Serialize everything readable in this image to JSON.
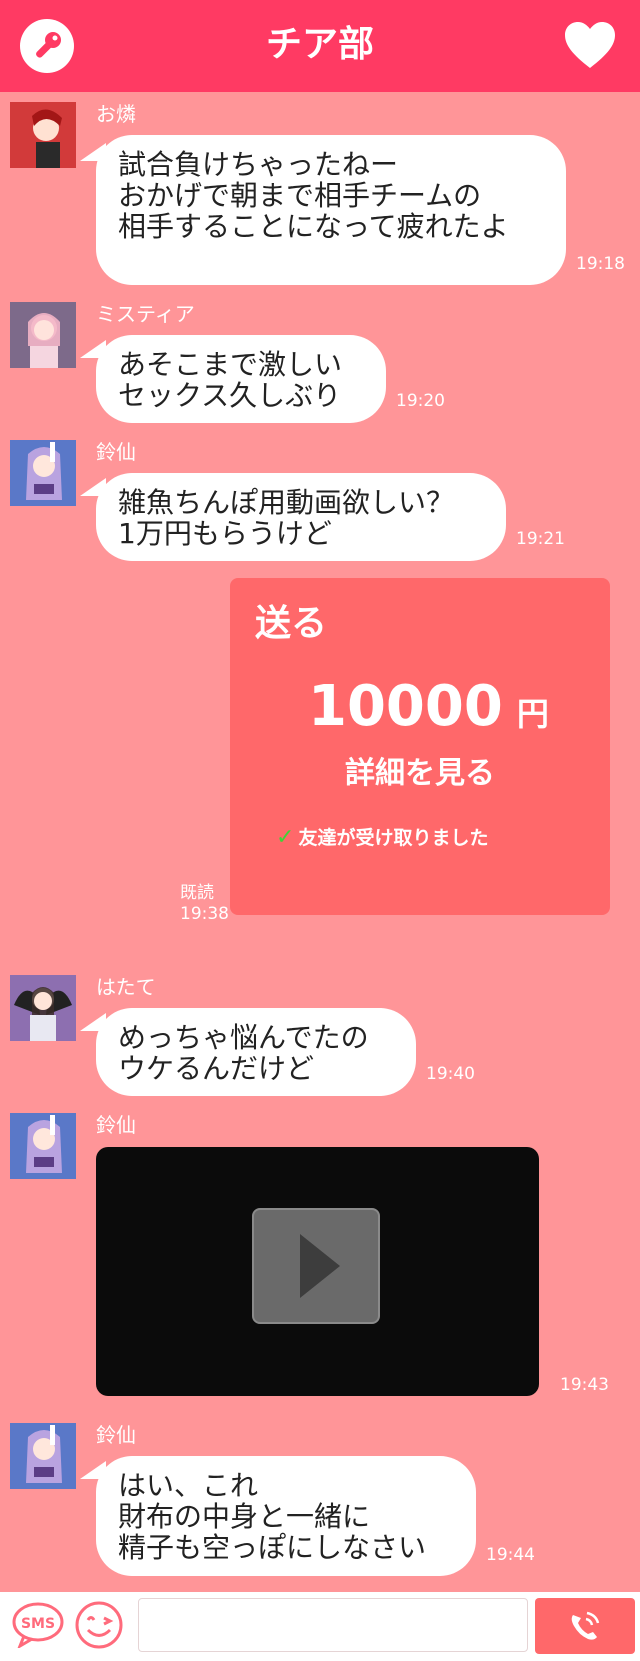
{
  "header": {
    "title": "チア部",
    "left_icon": "key-icon",
    "right_icon": "heart-icon"
  },
  "messages": [
    {
      "sender": "お燐",
      "text": "試合負けちゃったねー\nおかげで朝まで相手チームの\n相手することになって疲れたよ",
      "time": "19:18"
    },
    {
      "sender": "ミスティア",
      "text": "あそこまで激しい\nセックス久しぶり",
      "time": "19:20"
    },
    {
      "sender": "鈴仙",
      "text": "雑魚ちんぽ用動画欲しい？\n1万円もらうけど",
      "time": "19:21"
    },
    {
      "sender": "はたて",
      "text": "めっちゃ悩んでたの\nウケるんだけど",
      "time": "19:40"
    },
    {
      "sender": "鈴仙",
      "video": true,
      "time": "19:43"
    },
    {
      "sender": "鈴仙",
      "text": "はい、これ\n財布の中身と一緒に\n精子も空っぽにしなさい",
      "time": "19:44"
    }
  ],
  "transfer": {
    "label": "送る",
    "amount": "10000",
    "currency": "円",
    "details_label": "詳細を見る",
    "status": "友達が受け取りました",
    "read_label": "既読",
    "time": "19:38"
  },
  "bottom_bar": {
    "sms_label": "SMS",
    "input_value": "",
    "input_placeholder": ""
  },
  "colors": {
    "header": "#ff3a63",
    "background": "#ff9598",
    "transfer_card": "#ff686a",
    "check": "#41d238"
  }
}
